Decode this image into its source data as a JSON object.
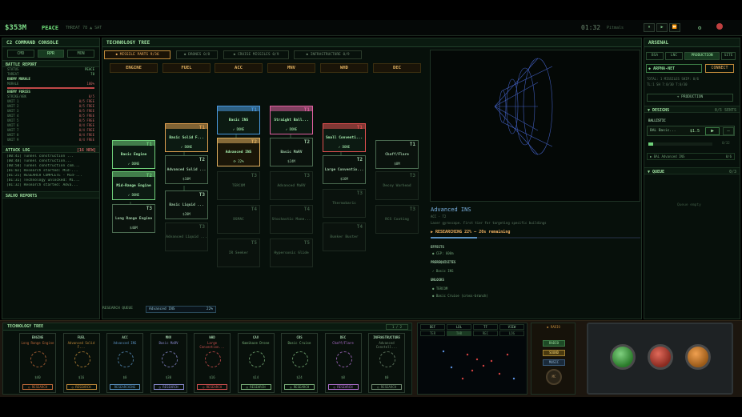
{
  "topbar": {
    "money": "$353M",
    "status": "PEACE",
    "threat": "THREAT 78 ▲ SAT",
    "clock": "01:32",
    "speed": "Pitmals",
    "controls": [
      "⏸",
      "▶",
      "⏩"
    ]
  },
  "c2": {
    "title": "C2 COMMAND CONSOLE",
    "tabs": [
      "CMD",
      "RPR",
      "MON"
    ],
    "battle": {
      "title": "BATTLE REPORT",
      "status_label": "STATUS",
      "status_value": "PEACE",
      "threat_label": "THREAT",
      "threat_value": "78",
      "enemy_label": "ENEMY MORALE",
      "morale_label": "MORALE",
      "morale_value": "100%",
      "forces_label": "ENEMY FORCES",
      "forces": [
        [
          "STRIKE/ABK",
          "0/5"
        ],
        [
          "UNIT 1",
          "0/5 FREE"
        ],
        [
          "UNIT 2",
          "0/5 FREE"
        ],
        [
          "UNIT 3",
          "0/5 FREE"
        ],
        [
          "UNIT 4",
          "0/5 FREE"
        ],
        [
          "UNIT 5",
          "0/5 FREE"
        ],
        [
          "UNIT 6",
          "0/4 FREE"
        ],
        [
          "UNIT 7",
          "0/4 FREE"
        ],
        [
          "UNIT 8",
          "0/4 FREE"
        ],
        [
          "UNIT 9",
          "0/4 FREE"
        ]
      ]
    },
    "attack": {
      "title": "ATTACK LOG",
      "badge": "[16 NEW]",
      "lines": [
        "[00:41] Tunnel construction ...",
        "[00:48] Tunnel construction...",
        "[00:50] Tunnel construction com...",
        "[01:02] Research started: Mid-...",
        "[01:21] RESEARCH COMPLETE - Mid-...",
        "[01:31] Technology unlocked: Mi...",
        "[01:32] Research started: Adva..."
      ]
    },
    "salvo": "SALVO REPORTS"
  },
  "tech": {
    "title": "TECHNOLOGY TREE",
    "cats": [
      {
        "label": "◆ MISSILE PARTS",
        "badge": "9/36"
      },
      {
        "label": "◆ DRONES",
        "badge": "0/8"
      },
      {
        "label": "◆ CRUISE MISSILES",
        "badge": "0/9"
      },
      {
        "label": "◆ INFRASTRUCTURE",
        "badge": "0/9"
      }
    ],
    "cols": [
      "ENGINE",
      "FUEL",
      "ACC",
      "MNV",
      "WHD",
      "DEC"
    ],
    "nodes": [
      {
        "t": "T1",
        "n": "Basic Engine",
        "s": "✓ DONE"
      },
      {
        "t": "T2",
        "n": "Mid-Range Engine",
        "s": "✓ DONE"
      },
      {
        "t": "T3",
        "n": "Long Range Engine",
        "s": "$40M"
      },
      {
        "t": "T1",
        "n": "Basic Solid F...",
        "s": "✓ DONE"
      },
      {
        "t": "T2",
        "n": "Advanced Solid ...",
        "s": "$10M"
      },
      {
        "t": "T3",
        "n": "Basic Liquid ...",
        "s": "$20M"
      },
      {
        "t": "T1",
        "n": "Basic INS",
        "s": "✓ DONE"
      },
      {
        "t": "T2",
        "n": "Advanced INS",
        "s": "⟳ 22%"
      },
      {
        "t": "T1",
        "n": "Straight Ball...",
        "s": "✓ DONE"
      },
      {
        "t": "T2",
        "n": "Basic MaRV",
        "s": "$24M"
      },
      {
        "t": "T1",
        "n": "Small Conventi...",
        "s": "✓ DONE"
      },
      {
        "t": "T2",
        "n": "Large Conventio...",
        "s": "$16M"
      },
      {
        "t": "T1",
        "n": "Chaff/Flare",
        "s": "$8M"
      },
      {
        "t": "T3",
        "n": "TERCOM",
        "s": ""
      },
      {
        "t": "T3",
        "n": "Advanced MaRV",
        "s": ""
      },
      {
        "t": "T3",
        "n": "Thermobaric",
        "s": ""
      },
      {
        "t": "T3",
        "n": "Decoy Warhead",
        "s": ""
      },
      {
        "t": "T4",
        "n": "DSMAC",
        "s": ""
      },
      {
        "t": "T4",
        "n": "Stochastic Mane...",
        "s": ""
      },
      {
        "t": "T4",
        "n": "Bunker Buster",
        "s": ""
      },
      {
        "t": "T3",
        "n": "RCS Coating",
        "s": ""
      },
      {
        "t": "T5",
        "n": "IR Seeker",
        "s": ""
      },
      {
        "t": "T5",
        "n": "Hypersonic Glide",
        "s": ""
      },
      {
        "t": "T3",
        "n": "Advanced Liquid ...",
        "s": ""
      }
    ],
    "detail": {
      "name": "Advanced INS",
      "sub": "ACC · T2",
      "desc": "Laser gyroscope. First tier for targeting specific buildings",
      "progress_label": "▶ RESEARCHING 22% — 20s remaining",
      "progress": 0.22,
      "effects_h": "EFFECTS",
      "effects": [
        "● CEP: 600m"
      ],
      "prereq_h": "PREREQUISITES",
      "prereq": [
        "✓ Basic INS"
      ],
      "unlocks_h": "UNLOCKS",
      "unlocks": [
        "● TERCOM",
        "● Basic Cruise (cross-branch)"
      ]
    },
    "queue_label": "RESEARCH QUEUE",
    "queue_item": "Advanced INS",
    "queue_pct": "22%"
  },
  "arsenal": {
    "title": "ARSENAL",
    "tabs": [
      "BSA",
      "LNC",
      "PRODUCTION",
      "SITE"
    ],
    "buyer": "◆ ARPNA-NET",
    "connect": "CONNECT",
    "info1": "TOTAL: 1 MISSILES SHIP: 0/6",
    "info2": "TL:1 SH 7:0/30 T:0/30",
    "production": "+ PRODUCTION",
    "designs": "▼ DESIGNS",
    "designs_count": "0/5 SENTS",
    "ballistic": "BALLISTIC",
    "bal_name": "BAL Basic...",
    "bal_price": "$1.5",
    "bal_count": "0/32",
    "research_line": "▶ BAL Advanced INS",
    "research_pct": "0/6",
    "queue": "▼ QUEUE",
    "queue_count": "0/3",
    "queue_empty": "Queue empty"
  },
  "bottom": {
    "title": "TECHNOLOGY TREE",
    "pager": "1 / 2",
    "cards": [
      {
        "h": "ENGINE",
        "n": "Long Range Engine",
        "p": "$40",
        "s": "◎ RESEARCH",
        "c": "#c06a3a"
      },
      {
        "h": "FUEL",
        "n": "Advanced Solid F...",
        "p": "$16",
        "s": "◎ RESEARCH",
        "c": "#c08a3a"
      },
      {
        "h": "ACC",
        "n": "Advanced INS",
        "p": "$0",
        "s": "RESEARCHING",
        "c": "#5a90c0"
      },
      {
        "h": "MNV",
        "n": "Basic MaRV",
        "p": "$30",
        "s": "◎ RESEARCH",
        "c": "#8a8ad0"
      },
      {
        "h": "WHD",
        "n": "Large Convention...",
        "p": "$16",
        "s": "◎ RESEARCH",
        "c": "#d05050"
      },
      {
        "h": "CAV",
        "n": "Kamikaze Drone",
        "p": "$14",
        "s": "◎ RESEARCH",
        "c": "#7ab07a"
      },
      {
        "h": "CRS",
        "n": "Basic Cruise",
        "p": "$24",
        "s": "◎ RESEARCH",
        "c": "#7ab07a"
      },
      {
        "h": "DEC",
        "n": "Chaff/Flare",
        "p": "$8",
        "s": "◎ RESEARCH",
        "c": "#b070d0"
      },
      {
        "h": "INFRASTRUCTURE",
        "n": "Advanced Constell...",
        "p": "$0",
        "s": "◎ RESEARCH",
        "c": "#6f8a70"
      }
    ],
    "map_tabs": [
      "DEF",
      "LDL",
      "TF",
      "VIEW"
    ],
    "map_sub": [
      "TER",
      "THR",
      "REC",
      "LOG"
    ],
    "radio_title": "◆ RADIO",
    "radio_btns": [
      "RADIO",
      "SOUND",
      "MUSIC"
    ],
    "vol": "MC"
  }
}
